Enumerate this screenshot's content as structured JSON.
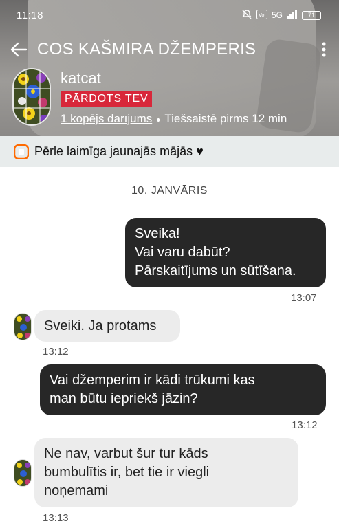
{
  "status_bar": {
    "time": "11:18",
    "network": "5G",
    "battery": "71"
  },
  "header": {
    "title": "COS KAŠMIRA DŽEMPERIS",
    "username": "katcat",
    "sold_badge": "PĀRDOTS TEV",
    "deals_link": "1 kopējs darījums",
    "separator": "♦",
    "online_status": "Tiešsaistē pirms 12 min"
  },
  "notice": {
    "text": "Pērle laimīga jaunajās mājās ♥"
  },
  "chat": {
    "date": "10. JANVĀRIS",
    "messages": [
      {
        "lines": [
          "Sveika!",
          "Vai varu dabūt?",
          "Pārskaitījums un sūtīšana."
        ],
        "time": "13:07"
      },
      {
        "lines": [
          "Sveiki. Ja protams"
        ],
        "time": "13:12"
      },
      {
        "lines": [
          "Vai džemperim ir kādi trūkumi kas",
          "man būtu iepriekš jāzin?"
        ],
        "time": "13:12"
      },
      {
        "lines": [
          "Ne nav, varbut šur tur kāds",
          "bumbulītis ir, bet tie ir viegli",
          "noņemami"
        ],
        "time": "13:13"
      }
    ]
  },
  "colors": {
    "sold_badge": "#d8273a",
    "outgoing_bubble": "#272727",
    "incoming_bubble": "#ececec",
    "notice_bg": "#e8ecec",
    "notice_icon": "#ff6a00"
  }
}
